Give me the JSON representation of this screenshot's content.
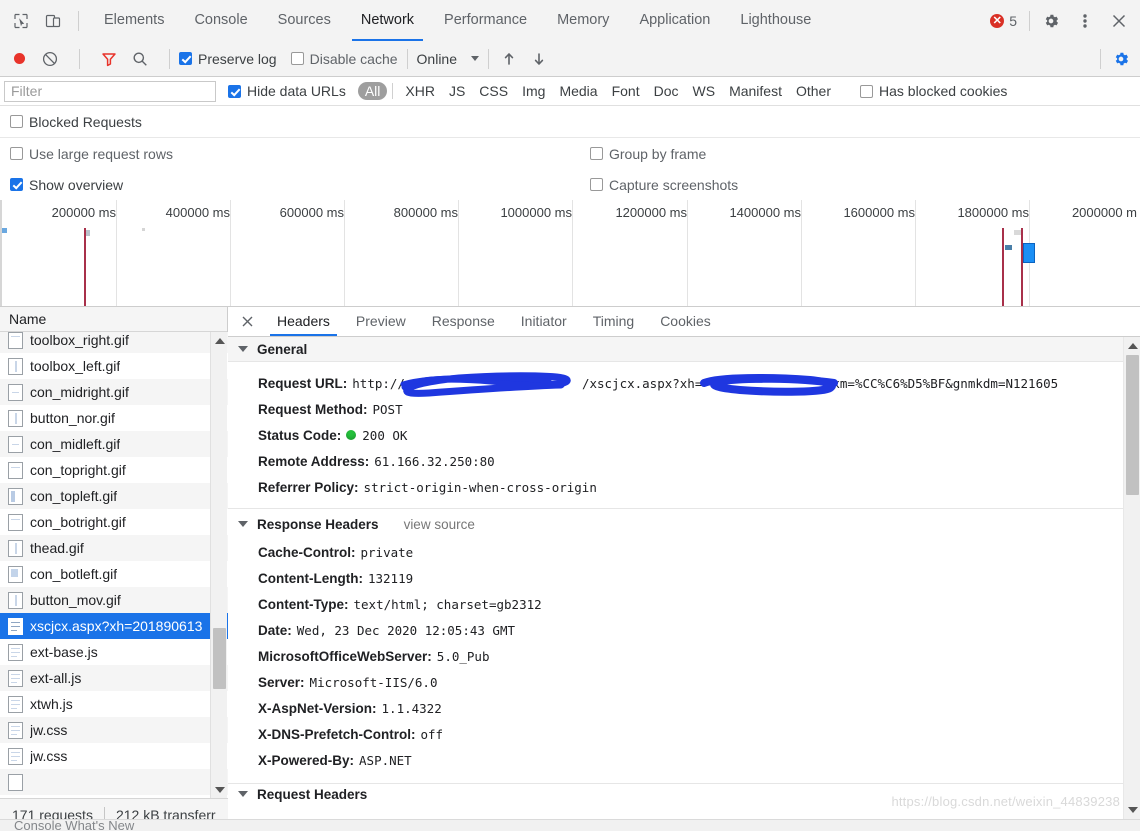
{
  "devtools": {
    "main_tabs": [
      {
        "label": "Elements",
        "active": false
      },
      {
        "label": "Console",
        "active": false
      },
      {
        "label": "Sources",
        "active": false
      },
      {
        "label": "Network",
        "active": true
      },
      {
        "label": "Performance",
        "active": false
      },
      {
        "label": "Memory",
        "active": false
      },
      {
        "label": "Application",
        "active": false
      },
      {
        "label": "Lighthouse",
        "active": false
      }
    ],
    "error_count": "5",
    "error_glyph": "✕",
    "icons": {
      "inspect": "inspect-element-icon",
      "device": "device-toolbar-icon",
      "settings": "gear-icon",
      "more": "kebab-menu-icon",
      "close": "close-icon"
    }
  },
  "toolbar": {
    "record_label": "record-button",
    "clear_label": "clear-button",
    "filter_label": "filter-button",
    "search_label": "search-button",
    "preserve_log": "Preserve log",
    "preserve_log_checked": true,
    "disable_cache": "Disable cache",
    "disable_cache_checked": false,
    "throttle_value": "Online",
    "import_har": "import-har-icon",
    "export_har": "export-har-icon",
    "network_settings": "network-settings-gear-icon"
  },
  "filter": {
    "placeholder": "Filter",
    "value": "",
    "hide_data_urls": "Hide data URLs",
    "hide_data_urls_checked": true,
    "types": [
      "All",
      "XHR",
      "JS",
      "CSS",
      "Img",
      "Media",
      "Font",
      "Doc",
      "WS",
      "Manifest",
      "Other"
    ],
    "selected_type": "All",
    "has_blocked_cookies": "Has blocked cookies",
    "has_blocked_cookies_checked": false
  },
  "settings": {
    "blocked_requests": "Blocked Requests",
    "blocked_requests_checked": false,
    "use_large_request_rows": "Use large request rows",
    "use_large_request_rows_checked": false,
    "group_by_frame": "Group by frame",
    "group_by_frame_checked": false,
    "show_overview": "Show overview",
    "show_overview_checked": true,
    "capture_screenshots": "Capture screenshots",
    "capture_screenshots_checked": false
  },
  "overview": {
    "ticks": [
      "200000 ms",
      "400000 ms",
      "600000 ms",
      "800000 ms",
      "1000000 ms",
      "1200000 ms",
      "1400000 ms",
      "1600000 ms",
      "1800000 ms",
      "2000000 m"
    ],
    "unit": "ms",
    "interval": 200000,
    "max": 2000000
  },
  "requests": {
    "column_header": "Name",
    "selected_index": 11,
    "items": [
      {
        "name": "toolbox_right.gif",
        "type": "image"
      },
      {
        "name": "toolbox_left.gif",
        "type": "image"
      },
      {
        "name": "con_midright.gif",
        "type": "image"
      },
      {
        "name": "button_nor.gif",
        "type": "image"
      },
      {
        "name": "con_midleft.gif",
        "type": "image"
      },
      {
        "name": "con_topright.gif",
        "type": "image"
      },
      {
        "name": "con_topleft.gif",
        "type": "image"
      },
      {
        "name": "con_botright.gif",
        "type": "image"
      },
      {
        "name": "thead.gif",
        "type": "image"
      },
      {
        "name": "con_botleft.gif",
        "type": "image"
      },
      {
        "name": "button_mov.gif",
        "type": "image"
      },
      {
        "name": "xscjcx.aspx?xh=201890613",
        "type": "document"
      },
      {
        "name": "ext-base.js",
        "type": "script"
      },
      {
        "name": "ext-all.js",
        "type": "script"
      },
      {
        "name": "xtwh.js",
        "type": "script"
      },
      {
        "name": "jw.css",
        "type": "stylesheet"
      },
      {
        "name": "jw.css",
        "type": "stylesheet"
      }
    ],
    "status": {
      "requests": "171 requests",
      "transferred": "212 kB transferr"
    }
  },
  "details": {
    "tabs": [
      {
        "label": "Headers",
        "active": true
      },
      {
        "label": "Preview",
        "active": false
      },
      {
        "label": "Response",
        "active": false
      },
      {
        "label": "Initiator",
        "active": false
      },
      {
        "label": "Timing",
        "active": false
      },
      {
        "label": "Cookies",
        "active": false
      }
    ],
    "general": {
      "title": "General",
      "request_url_key": "Request URL:",
      "request_url_prefix": "http://",
      "request_url_mid": "/xscjcx.aspx?xh=",
      "request_url_suffix": "xm=%CC%C6%D5%BF&gnmkdm=N121605",
      "rows": [
        {
          "key": "Request Method:",
          "value": "POST"
        },
        {
          "key": "Status Code:",
          "value": "200 OK",
          "dot": true
        },
        {
          "key": "Remote Address:",
          "value": "61.166.32.250:80"
        },
        {
          "key": "Referrer Policy:",
          "value": "strict-origin-when-cross-origin"
        }
      ]
    },
    "response_headers": {
      "title": "Response Headers",
      "view_source": "view source",
      "rows": [
        {
          "key": "Cache-Control:",
          "value": "private"
        },
        {
          "key": "Content-Length:",
          "value": "132119"
        },
        {
          "key": "Content-Type:",
          "value": "text/html; charset=gb2312"
        },
        {
          "key": "Date:",
          "value": "Wed, 23 Dec 2020 12:05:43 GMT"
        },
        {
          "key": "MicrosoftOfficeWebServer:",
          "value": "5.0_Pub"
        },
        {
          "key": "Server:",
          "value": "Microsoft-IIS/6.0"
        },
        {
          "key": "X-AspNet-Version:",
          "value": "1.1.4322"
        },
        {
          "key": "X-DNS-Prefetch-Control:",
          "value": "off"
        },
        {
          "key": "X-Powered-By:",
          "value": "ASP.NET"
        }
      ]
    },
    "request_headers": {
      "title": "Request Headers"
    }
  },
  "watermark": "https://blog.csdn.net/weixin_44839238",
  "bottom_strip": "Console    What's New",
  "colors": {
    "accent": "#1a73e8",
    "error": "#d93025",
    "record": "#e8332a",
    "filter_red": "#e8332a",
    "status_ok": "#24c03b",
    "selection": "#1a73e8",
    "timeline_red": "#a8304a",
    "redaction": "#1f37e0"
  }
}
